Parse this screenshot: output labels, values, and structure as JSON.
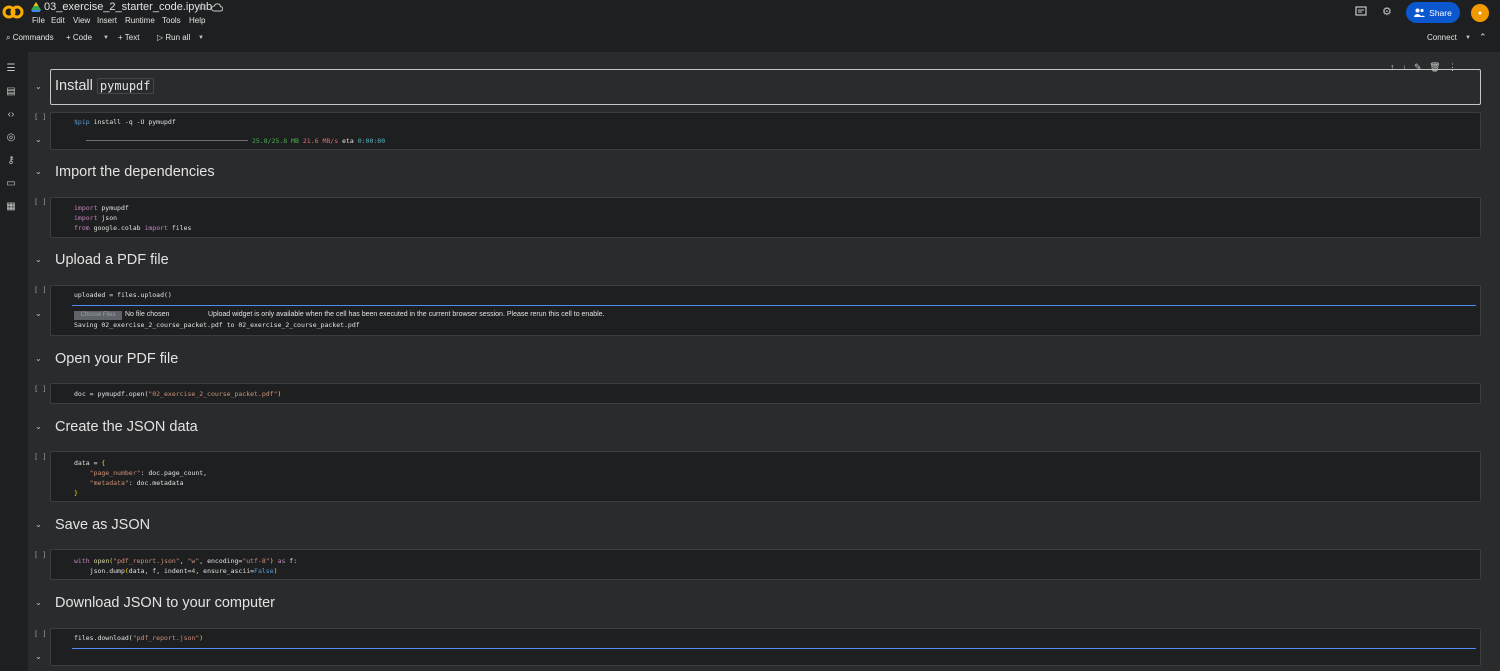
{
  "app": {
    "filename": "03_exercise_2_starter_code.ipynb",
    "menus": [
      "File",
      "Edit",
      "View",
      "Insert",
      "Runtime",
      "Tools",
      "Help"
    ],
    "share_label": "Share"
  },
  "toolbar": {
    "commands_label": "Commands",
    "code_label": "Code",
    "text_label": "Text",
    "run_all_label": "Run all",
    "connect_label": "Connect"
  },
  "sections": {
    "install": {
      "title_prefix": "Install",
      "title_code": "pymupdf"
    },
    "import": {
      "title": "Import the dependencies"
    },
    "upload": {
      "title": "Upload a PDF file"
    },
    "open": {
      "title": "Open your PDF file"
    },
    "create": {
      "title": "Create the JSON data"
    },
    "save": {
      "title": "Save as JSON"
    },
    "download": {
      "title": "Download JSON to your computer"
    }
  },
  "cells": {
    "bracket": "[ ]",
    "pip_cmd": "$pip",
    "pip_rest": " install -q -U pymupdf",
    "progress_text": "25.8/25.8 MB",
    "speed_text": "21.6 MB/s",
    "eta_label": "eta",
    "eta_value": "0:00:00",
    "upload_code": "uploaded = files.upload()",
    "choose_files": "Choose Files",
    "no_file": "No file chosen",
    "upload_notice": "Upload widget is only available when the cell has been executed in the current browser session. Please rerun this cell to enable.",
    "saving_text": "Saving 02_exercise_2_course_packet.pdf to 02_exercise_2_course_packet.pdf",
    "open_pre": "doc = pymupdf.open(",
    "open_str": "\"02_exercise_2_course_packet.pdf\"",
    "download_pre": "files.download(",
    "download_str": "\"pdf_report.json\""
  }
}
